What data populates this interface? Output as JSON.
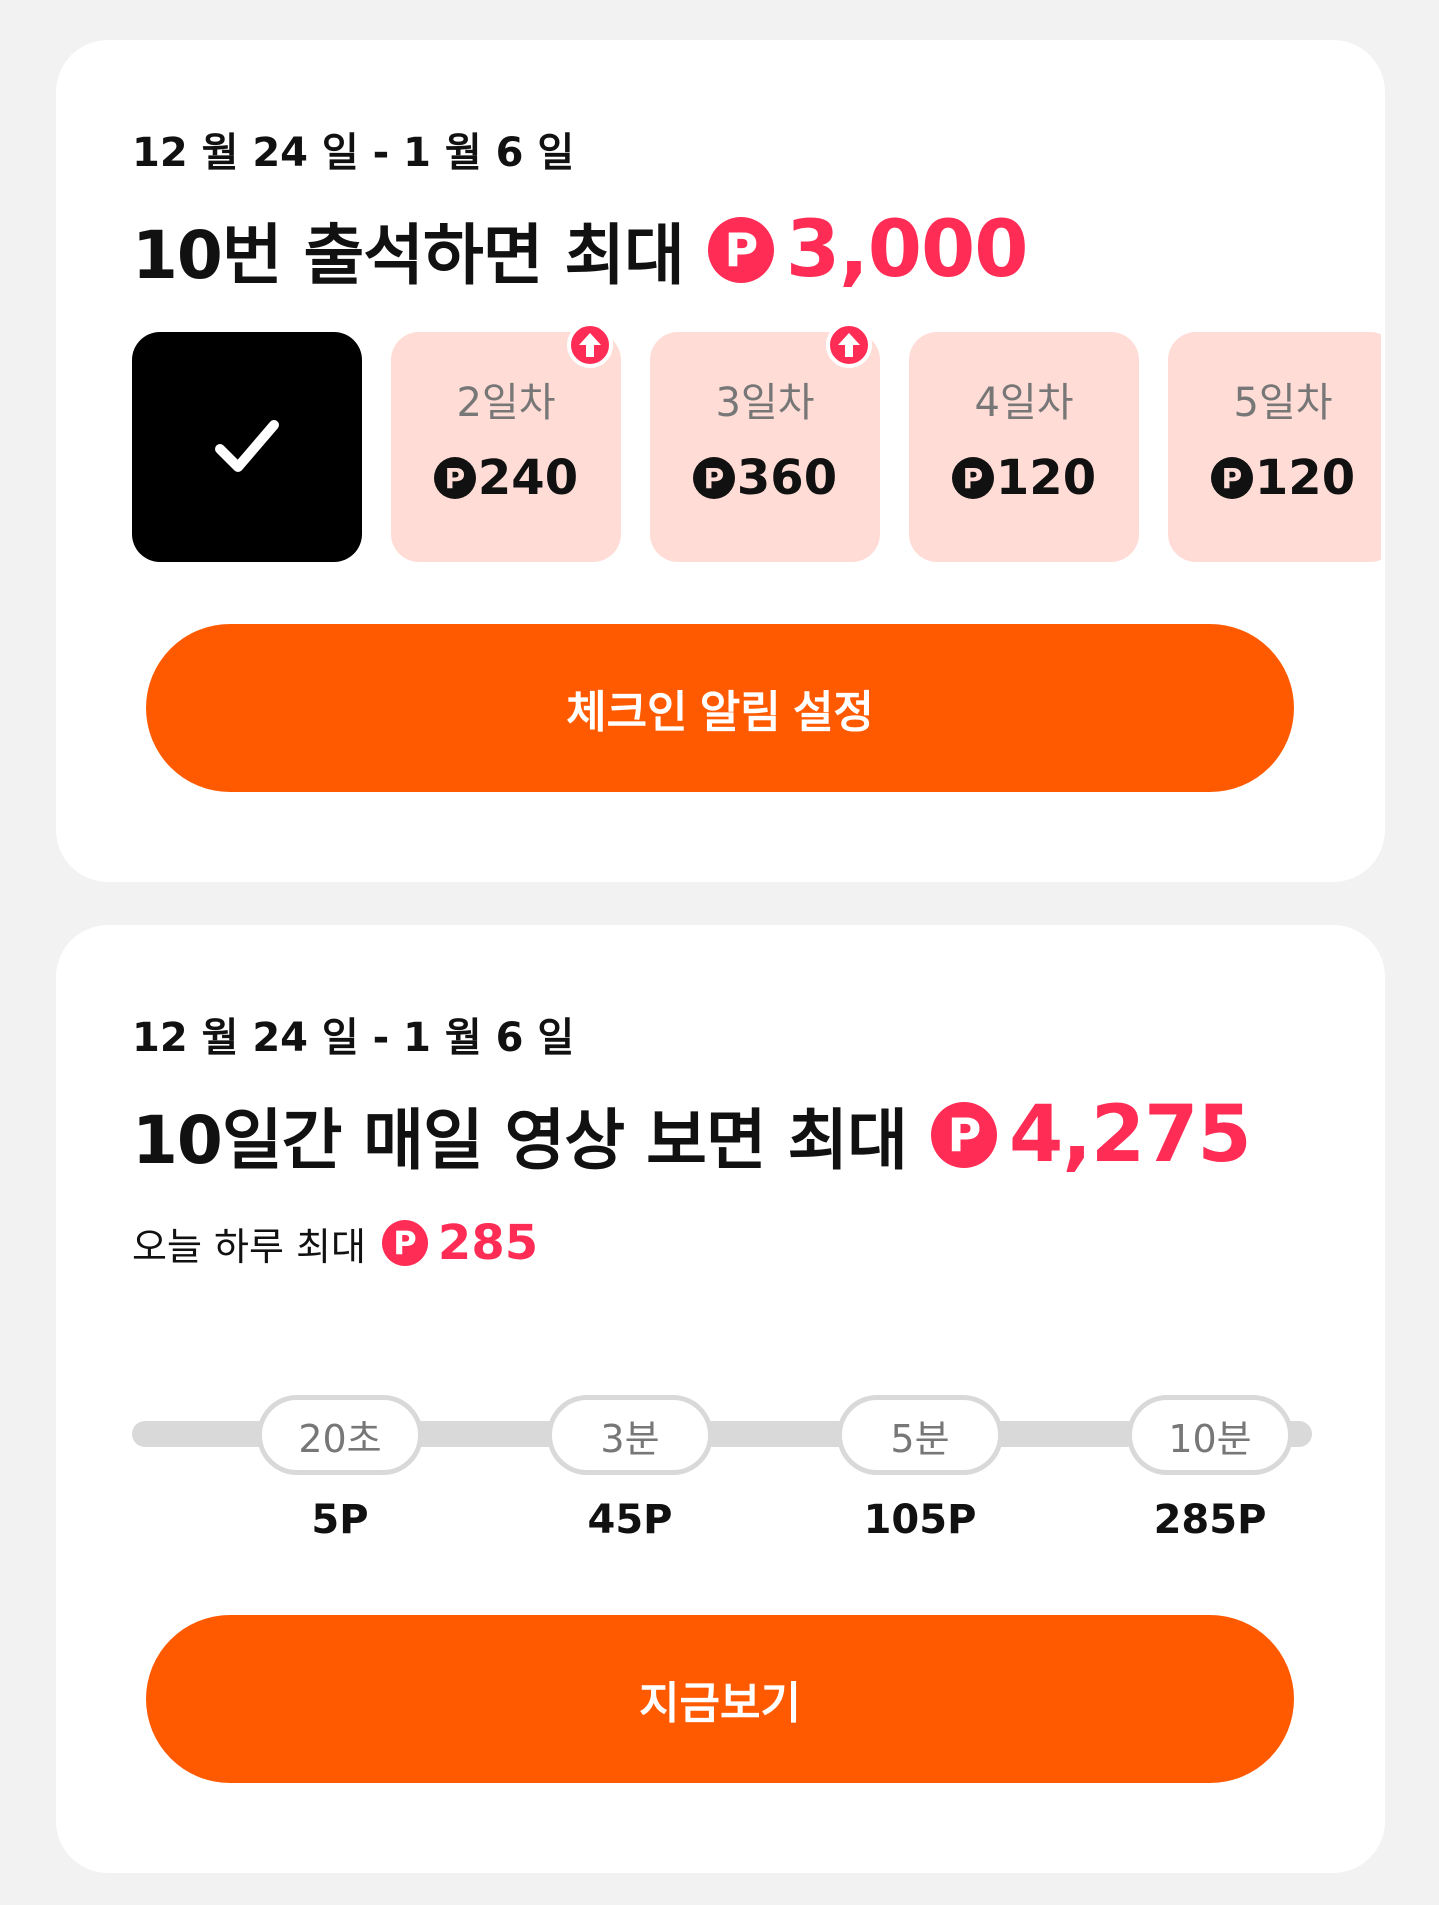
{
  "attendance": {
    "date_range": "12 월 24 일 - 1 월 6 일",
    "headline": "10번 출석하면 최대",
    "max_amount": "3,000",
    "point_symbol": "P",
    "days": [
      {
        "label": "",
        "reward": "",
        "checked": true,
        "boost": false
      },
      {
        "label": "2일차",
        "reward": "240",
        "checked": false,
        "boost": true
      },
      {
        "label": "3일차",
        "reward": "360",
        "checked": false,
        "boost": true
      },
      {
        "label": "4일차",
        "reward": "120",
        "checked": false,
        "boost": false
      },
      {
        "label": "5일차",
        "reward": "120",
        "checked": false,
        "boost": false
      }
    ],
    "cta_label": "체크인 알림 설정"
  },
  "video": {
    "date_range": "12 월 24 일 - 1 월 6 일",
    "headline": "10일간 매일 영상 보면 최대",
    "max_amount": "4,275",
    "today_label": "오늘 하루 최대",
    "today_amount": "285",
    "milestones": [
      {
        "time": "20초",
        "points": "5P"
      },
      {
        "time": "3분",
        "points": "45P"
      },
      {
        "time": "5분",
        "points": "105P"
      },
      {
        "time": "10분",
        "points": "285P"
      }
    ],
    "cta_label": "지금보기"
  },
  "colors": {
    "accent": "#ff2d55",
    "cta": "#ff5a00",
    "tile": "#ffdcd6",
    "track": "#d9d9d9"
  }
}
